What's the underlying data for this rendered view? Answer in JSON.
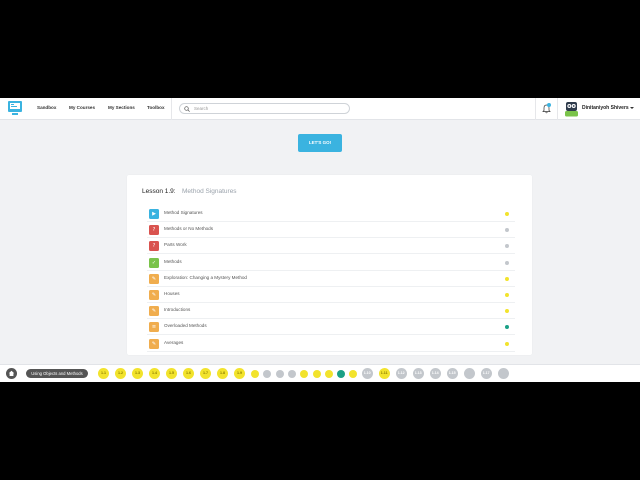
{
  "header": {
    "nav": [
      "Sandbox",
      "My Courses",
      "My Sections",
      "Toolbox"
    ],
    "search_placeholder": "Search",
    "username": "Dinitaniyoh Shivers",
    "avatar_badge": "Pro"
  },
  "cta": {
    "label": "LET'S GO!"
  },
  "lesson": {
    "title": "Lesson 1.9:",
    "subtitle": "Method Signatures",
    "items": [
      {
        "label": "Method Signatures",
        "icon": "video-icon",
        "icon_color": "#3ab3e0",
        "status_color": "#f2e32c"
      },
      {
        "label": "Methods or No Methods",
        "icon": "quiz-icon",
        "icon_color": "#d9534f",
        "status_color": "#c3c7cc"
      },
      {
        "label": "Parts Work",
        "icon": "quiz-icon",
        "icon_color": "#d9534f",
        "status_color": "#c3c7cc"
      },
      {
        "label": "Methods",
        "icon": "check-icon",
        "icon_color": "#7ac34a",
        "status_color": "#c3c7cc"
      },
      {
        "label": "Exploration: Changing a Mystery Method",
        "icon": "pencil-icon",
        "icon_color": "#f0ad4e",
        "status_color": "#f2e32c"
      },
      {
        "label": "Houses",
        "icon": "pencil-icon",
        "icon_color": "#f0ad4e",
        "status_color": "#f2e32c"
      },
      {
        "label": "Introductions",
        "icon": "pencil-icon",
        "icon_color": "#f0ad4e",
        "status_color": "#f2e32c"
      },
      {
        "label": "Overloaded Methods",
        "icon": "list-icon",
        "icon_color": "#f0ad4e",
        "status_color": "#1aa086"
      },
      {
        "label": "Averages",
        "icon": "pencil-icon",
        "icon_color": "#f0ad4e",
        "status_color": "#f2e32c"
      }
    ]
  },
  "bottombar": {
    "unit_label": "Using Objects and Methods",
    "steps": [
      {
        "label": "1.1",
        "color": "#f2e32c",
        "size": "big"
      },
      {
        "label": "1.2",
        "color": "#f2e32c",
        "size": "big"
      },
      {
        "label": "1.3",
        "color": "#f2e32c",
        "size": "big"
      },
      {
        "label": "1.4",
        "color": "#f2e32c",
        "size": "big"
      },
      {
        "label": "1.5",
        "color": "#f2e32c",
        "size": "big"
      },
      {
        "label": "1.6",
        "color": "#f2e32c",
        "size": "big"
      },
      {
        "label": "1.7",
        "color": "#f2e32c",
        "size": "big"
      },
      {
        "label": "1.8",
        "color": "#f2e32c",
        "size": "big"
      },
      {
        "label": "1.9",
        "color": "#f2e32c",
        "size": "big"
      },
      {
        "label": "",
        "color": "#f2e32c",
        "size": "small"
      },
      {
        "label": "",
        "color": "#c3c7cc",
        "size": "small"
      },
      {
        "label": "",
        "color": "#c3c7cc",
        "size": "small"
      },
      {
        "label": "",
        "color": "#c3c7cc",
        "size": "small"
      },
      {
        "label": "",
        "color": "#f2e32c",
        "size": "small"
      },
      {
        "label": "",
        "color": "#f2e32c",
        "size": "small"
      },
      {
        "label": "",
        "color": "#f2e32c",
        "size": "small"
      },
      {
        "label": "",
        "color": "#1aa086",
        "size": "small"
      },
      {
        "label": "",
        "color": "#f2e32c",
        "size": "small"
      },
      {
        "label": "1.10",
        "color": "#c3c7cc",
        "size": "big"
      },
      {
        "label": "1.11",
        "color": "#f2e32c",
        "size": "big"
      },
      {
        "label": "1.12",
        "color": "#c3c7cc",
        "size": "big"
      },
      {
        "label": "1.13",
        "color": "#c3c7cc",
        "size": "big"
      },
      {
        "label": "1.14",
        "color": "#c3c7cc",
        "size": "big"
      },
      {
        "label": "1.15",
        "color": "#c3c7cc",
        "size": "big"
      },
      {
        "label": "",
        "color": "#c3c7cc",
        "size": "big"
      },
      {
        "label": "1.17",
        "color": "#c3c7cc",
        "size": "big"
      },
      {
        "label": "",
        "color": "#c3c7cc",
        "size": "big"
      }
    ]
  }
}
